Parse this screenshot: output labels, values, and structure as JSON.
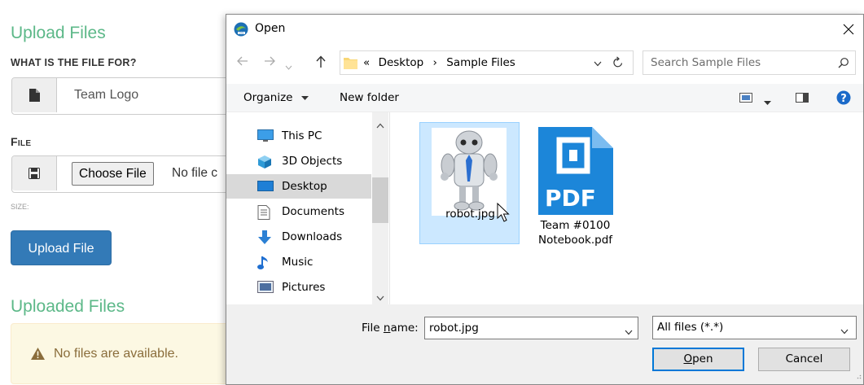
{
  "web": {
    "upload_heading": "Upload Files",
    "purpose_label": "What is the file for?",
    "purpose_value": "Team Logo",
    "file_label": "File",
    "choose_file": "Choose File",
    "no_file": "No file c",
    "size_label": "SIZE:",
    "upload_button": "Upload File",
    "uploaded_heading": "Uploaded Files",
    "alert_text": "No files are available."
  },
  "dialog": {
    "title": "Open",
    "breadcrumb": {
      "prefix": "«",
      "items": [
        "Desktop",
        "Sample Files"
      ],
      "separator": "›"
    },
    "search_placeholder": "Search Sample Files",
    "toolbar": {
      "organize": "Organize",
      "new_folder": "New folder"
    },
    "nav_items": [
      {
        "label": "This PC",
        "icon": "monitor-icon"
      },
      {
        "label": "3D Objects",
        "icon": "cube-icon"
      },
      {
        "label": "Desktop",
        "icon": "desktop-icon",
        "selected": true
      },
      {
        "label": "Documents",
        "icon": "document-icon"
      },
      {
        "label": "Downloads",
        "icon": "download-icon"
      },
      {
        "label": "Music",
        "icon": "music-note-icon"
      },
      {
        "label": "Pictures",
        "icon": "picture-icon"
      }
    ],
    "files": [
      {
        "name": "robot.jpg",
        "selected": true,
        "icon": "robot-thumbnail"
      },
      {
        "name_line1": "Team #0100",
        "name_line2": "Notebook.pdf",
        "icon": "pdf-file-icon"
      }
    ],
    "pdf_label": "PDF",
    "file_name_label_prefix": "File ",
    "file_name_label_mnemonic": "n",
    "file_name_label_suffix": "ame:",
    "file_name_value": "robot.jpg",
    "file_type_value": "All files (*.*)",
    "open_button_mnemonic": "O",
    "open_button_rest": "pen",
    "cancel_button": "Cancel"
  },
  "colors": {
    "heading_green": "#5cb888",
    "primary_blue": "#337ab7",
    "selection_blue": "#cce8ff",
    "accent_blue": "#0078d7",
    "alert_bg": "#fcf8e3"
  }
}
